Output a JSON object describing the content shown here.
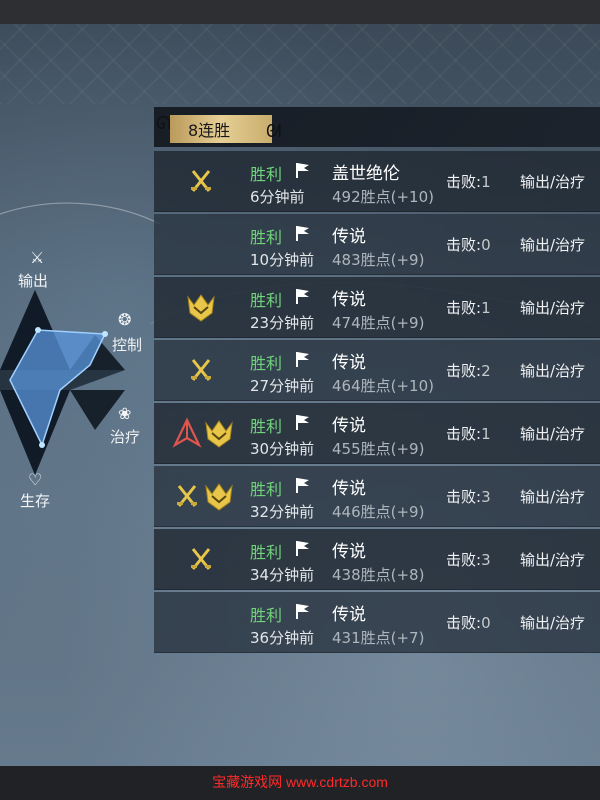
{
  "streak_badge": "8连胜",
  "roles": {
    "output": "输出",
    "control": "控制",
    "heal": "治疗",
    "survive": "生存"
  },
  "kills_label": "击败:",
  "matches": [
    {
      "result": "胜利",
      "time": "6分钟前",
      "rank": "盖世绝伦",
      "points": "492胜点",
      "delta": "(+10)",
      "kills": "1",
      "role": "输出/治疗",
      "icons": [
        "swords-icon"
      ]
    },
    {
      "result": "胜利",
      "time": "10分钟前",
      "rank": "传说",
      "points": "483胜点",
      "delta": "(+9)",
      "kills": "0",
      "role": "输出/治疗",
      "icons": []
    },
    {
      "result": "胜利",
      "time": "23分钟前",
      "rank": "传说",
      "points": "474胜点",
      "delta": "(+9)",
      "kills": "1",
      "role": "输出/治疗",
      "icons": [
        "crest-icon"
      ]
    },
    {
      "result": "胜利",
      "time": "27分钟前",
      "rank": "传说",
      "points": "464胜点",
      "delta": "(+10)",
      "kills": "2",
      "role": "输出/治疗",
      "icons": [
        "swords-icon"
      ]
    },
    {
      "result": "胜利",
      "time": "30分钟前",
      "rank": "传说",
      "points": "455胜点",
      "delta": "(+9)",
      "kills": "1",
      "role": "输出/治疗",
      "icons": [
        "red-arrow-icon",
        "crest-icon"
      ]
    },
    {
      "result": "胜利",
      "time": "32分钟前",
      "rank": "传说",
      "points": "446胜点",
      "delta": "(+9)",
      "kills": "3",
      "role": "输出/治疗",
      "icons": [
        "swords-icon",
        "crest-icon"
      ]
    },
    {
      "result": "胜利",
      "time": "34分钟前",
      "rank": "传说",
      "points": "438胜点",
      "delta": "(+8)",
      "kills": "3",
      "role": "输出/治疗",
      "icons": [
        "swords-icon"
      ]
    },
    {
      "result": "胜利",
      "time": "36分钟前",
      "rank": "传说",
      "points": "431胜点",
      "delta": "(+7)",
      "kills": "0",
      "role": "输出/治疗",
      "icons": []
    }
  ],
  "colors": {
    "win": "#6fd47a",
    "gold": "#e8c64a",
    "badge": "#d8bf82"
  },
  "watermark": "宝藏游戏网 www.cdrtzb.com"
}
